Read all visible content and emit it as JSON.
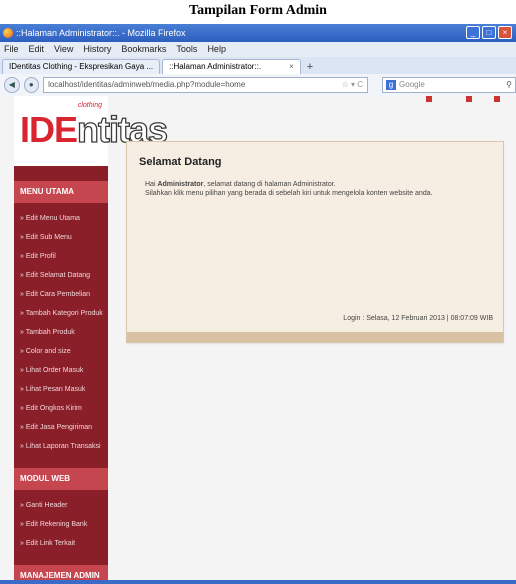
{
  "caption": "Tampilan Form Admin",
  "window": {
    "title": "::Halaman Administrator::. - Mozilla Firefox",
    "controls": [
      "_",
      "□",
      "×"
    ]
  },
  "menubar": [
    "File",
    "Edit",
    "View",
    "History",
    "Bookmarks",
    "Tools",
    "Help"
  ],
  "tabs": [
    {
      "label": "IDentitas Clothing - Ekspresikan Gaya ...",
      "active": false
    },
    {
      "label": "::Halaman Administrator::.",
      "active": true
    }
  ],
  "tab_add": "+",
  "nav": {
    "url": "localhost/identitas/adminweb/media.php?module=home",
    "search_placeholder": "Google"
  },
  "logo": {
    "part1": "IDE",
    "part2": "ntitas",
    "sub": "clothing"
  },
  "sidebar": {
    "menu_utama": {
      "header": "MENU UTAMA",
      "items": [
        "» Edit Menu Utama",
        "» Edit Sub Menu",
        "» Edit Profil",
        "» Edit Selamat Datang",
        "» Edit Cara Pembelian",
        "» Tambah Kategori Produk",
        "» Tambah Produk",
        "» Color and size",
        "» Lihat Order Masuk",
        "» Lihat Pesan Masuk",
        "» Edit Ongkos Kirim",
        "» Edit Jasa Pengiriman",
        "» Lihat Laporan Transaksi"
      ]
    },
    "modul_web": {
      "header": "MODUL WEB",
      "items": [
        "» Ganti Header",
        "» Edit Rekening Bank",
        "» Edit Link Terkait"
      ]
    },
    "manajemen": {
      "header": "MANAJEMEN ADMIN"
    }
  },
  "main": {
    "title": "Selamat Datang",
    "greeting_prefix": "Hai ",
    "greeting_name": "Administrator",
    "greeting_suffix": ", selamat datang di halaman Administrator.",
    "instruction": "Silahkan klik menu pilihan yang berada di sebelah kiri untuk mengelola konten website anda.",
    "login_info": "Login : Selasa, 12 Februari 2013 | 08:07:09 WIB"
  }
}
